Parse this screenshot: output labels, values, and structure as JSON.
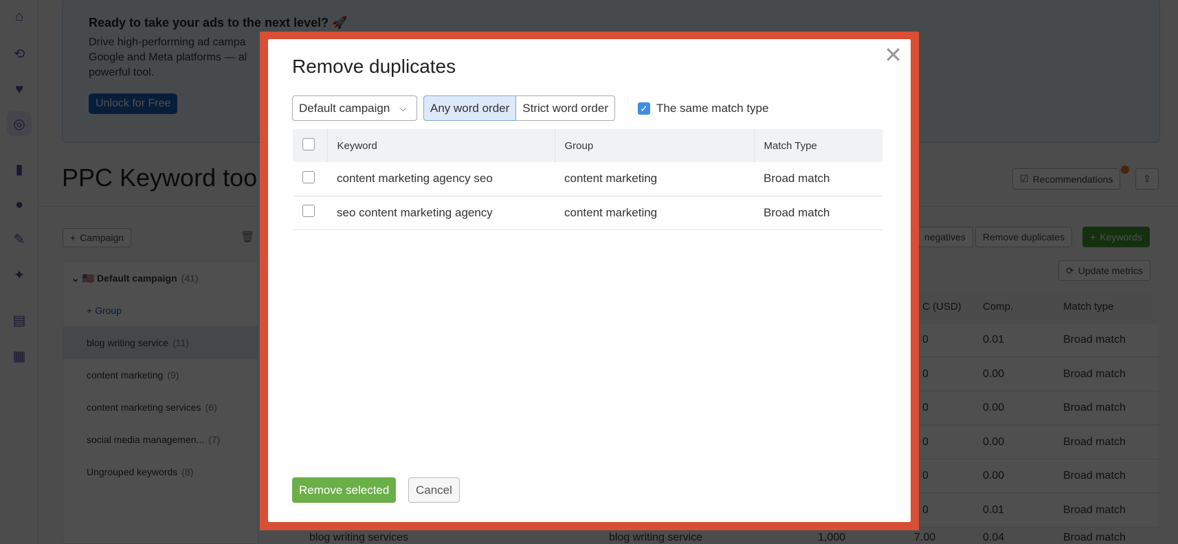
{
  "sidebar": {
    "icons": [
      "home-icon",
      "keyword-research-icon",
      "heart-chat-icon",
      "ppc-cursor-icon",
      "bar-chart-icon",
      "location-pin-icon",
      "pen-icon",
      "ai-sparkle-icon",
      "document-icon",
      "apps-icon"
    ]
  },
  "banner": {
    "title": "Ready to take your ads to the next level? 🚀",
    "text": "Drive high-performing ad campa... Google and Meta platforms — al... powerful tool.",
    "line1": "Drive high-performing ad campa",
    "line2": "Google and Meta platforms — al",
    "line3": "powerful tool.",
    "button": "Unlock for Free"
  },
  "page": {
    "title": "PPC Keyword too",
    "recommendations": "Recommendations",
    "campaign_button": "Campaign",
    "negatives": "negatives",
    "remove_duplicates": "Remove duplicates",
    "keywords_button": "Keywords",
    "update_metrics": "Update metrics"
  },
  "tree": {
    "campaign": "Default campaign",
    "campaign_count": "(41)",
    "add_group": "Group",
    "groups": [
      {
        "name": "blog writing service",
        "count": "(11)"
      },
      {
        "name": "content marketing",
        "count": "(9)"
      },
      {
        "name": "content marketing services",
        "count": "(6)"
      },
      {
        "name": "social media managemen...",
        "count": "(7)"
      },
      {
        "name": "Ungrouped keywords",
        "count": "(8)"
      }
    ]
  },
  "bg_table": {
    "headers": [
      "C (USD)",
      "Comp.",
      "Match type"
    ],
    "rows": [
      {
        "cpc": "0",
        "comp": "0.01",
        "match": "Broad match"
      },
      {
        "cpc": "0",
        "comp": "0.00",
        "match": "Broad match"
      },
      {
        "cpc": "0",
        "comp": "0.00",
        "match": "Broad match"
      },
      {
        "cpc": "0",
        "comp": "0.00",
        "match": "Broad match"
      },
      {
        "cpc": "0",
        "comp": "0.00",
        "match": "Broad match"
      },
      {
        "cpc": "0",
        "comp": "0.01",
        "match": "Broad match"
      }
    ],
    "last_row": {
      "keyword": "blog writing services",
      "group": "blog writing service",
      "volume": "1,000",
      "cpc": "7.00",
      "comp": "0.04",
      "match": "Broad match"
    }
  },
  "modal": {
    "title": "Remove duplicates",
    "campaign_select": "Default campaign",
    "any_order": "Any word order",
    "strict_order": "Strict word order",
    "same_match": "The same match type",
    "same_match_checked": true,
    "headers": [
      "Keyword",
      "Group",
      "Match Type"
    ],
    "rows": [
      {
        "keyword": "content marketing agency seo",
        "group": "content marketing",
        "match": "Broad match"
      },
      {
        "keyword": "seo content marketing agency",
        "group": "content marketing",
        "match": "Broad match"
      }
    ],
    "remove_selected": "Remove selected",
    "cancel": "Cancel"
  },
  "colors": {
    "frame": "#d94f35",
    "primary_green": "#6aaf47",
    "selected_segment": "#dde9f8",
    "checkbox": "#3d8ee0"
  }
}
